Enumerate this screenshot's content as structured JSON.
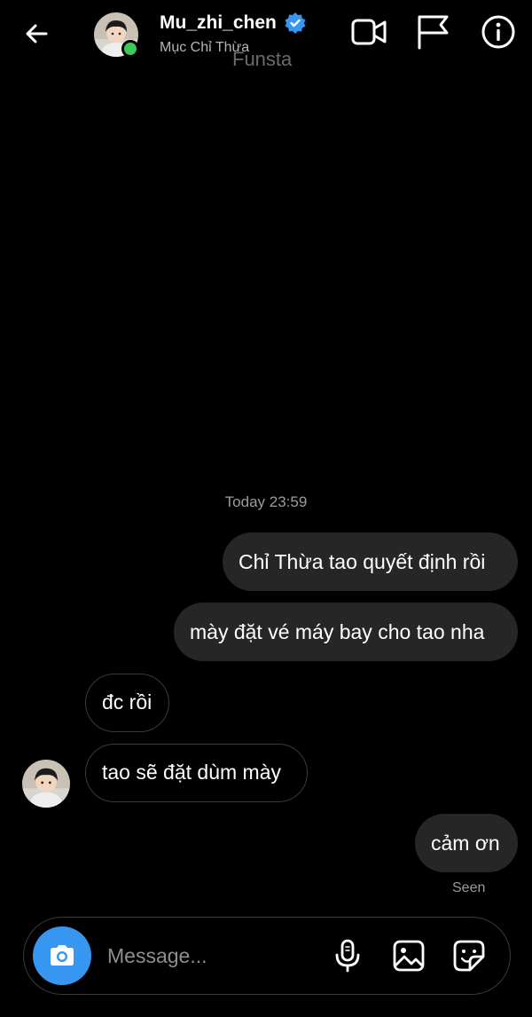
{
  "header": {
    "username": "Mu_zhi_chen",
    "display_name": "Mục Chỉ Thừa",
    "overlay_text": "Funsta",
    "online_color": "#3ec85b",
    "verified_color": "#3797f0",
    "icons": [
      "back-arrow-icon",
      "video-call-icon",
      "flag-icon",
      "info-icon"
    ]
  },
  "thread": {
    "timestamp": "Today 23:59",
    "messages": [
      {
        "from": "me",
        "text": "Chỉ Thừa tao quyết định rồi"
      },
      {
        "from": "me",
        "text": "mày đặt vé máy bay cho tao nha"
      },
      {
        "from": "them",
        "text": "đc rồi"
      },
      {
        "from": "them",
        "text": "tao sẽ đặt dùm mày"
      },
      {
        "from": "me",
        "text": "cảm ơn"
      }
    ],
    "seen_label": "Seen"
  },
  "composer": {
    "placeholder": "Message...",
    "camera_color": "#3797f0",
    "icons": [
      "camera-icon",
      "microphone-icon",
      "gallery-icon",
      "sticker-icon"
    ]
  }
}
